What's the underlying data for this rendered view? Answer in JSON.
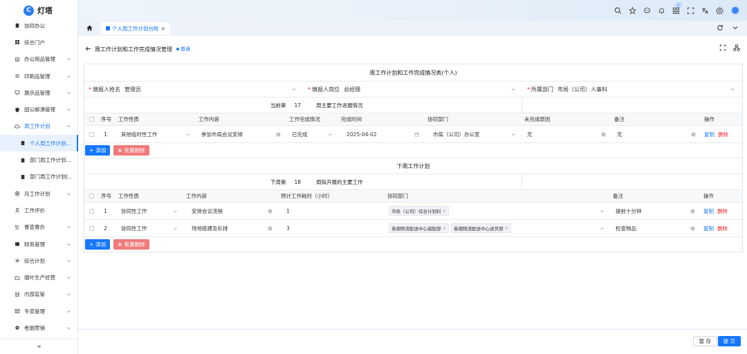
{
  "app": {
    "name": "灯塔",
    "logo_letter": "C"
  },
  "sidebar": {
    "items": [
      {
        "label": "协同办公",
        "icon": "doc-icon",
        "has_chevron": false
      },
      {
        "label": "综合门户",
        "icon": "grid-icon",
        "has_chevron": false
      },
      {
        "label": "办公用品管理",
        "icon": "box-icon",
        "has_chevron": true
      },
      {
        "label": "印刷品管理",
        "icon": "list-icon",
        "has_chevron": true
      },
      {
        "label": "展示品管理",
        "icon": "display-icon",
        "has_chevron": true
      },
      {
        "label": "固公邮湧管理",
        "icon": "shield-icon",
        "has_chevron": true
      },
      {
        "label": "周工作计划",
        "icon": "cloud-icon",
        "has_chevron": true,
        "open": true
      },
      {
        "label": "个人周工作计划...",
        "icon": "file-icon",
        "sub": true,
        "active": true
      },
      {
        "label": "部门周工作计划...",
        "icon": "file-icon",
        "sub": true
      },
      {
        "label": "部门周工作计划(...",
        "icon": "file-icon",
        "sub": true
      },
      {
        "label": "月工作计划",
        "icon": "target-icon",
        "has_chevron": true
      },
      {
        "label": "工作评价",
        "icon": "user-icon",
        "has_chevron": false
      },
      {
        "label": "督查督办",
        "icon": "flow-icon",
        "has_chevron": true
      },
      {
        "label": "财务管理",
        "icon": "finance-icon",
        "has_chevron": true
      },
      {
        "label": "综合计划",
        "icon": "sun-icon",
        "has_chevron": true
      },
      {
        "label": "烟叶生产经营",
        "icon": "folder-icon",
        "has_chevron": true
      },
      {
        "label": "内部监管",
        "icon": "monitor-icon",
        "has_chevron": true
      },
      {
        "label": "专卖管理",
        "icon": "table-icon",
        "has_chevron": true
      },
      {
        "label": "卷烟营销",
        "icon": "gear-icon",
        "has_chevron": true
      }
    ],
    "collapse_label": "«"
  },
  "topbar": {
    "badge": "新"
  },
  "tabs": {
    "active_label": "个人周工作计划台账",
    "close": "×"
  },
  "page": {
    "title": "周工作计划和工作完成情况管理",
    "status": "普通"
  },
  "form": {
    "title": "周工作计划和工作完成情况表(个人)",
    "fields": [
      {
        "label": "填报人姓名",
        "value": "管理员"
      },
      {
        "label": "填报人岗位",
        "value": "总经理"
      },
      {
        "label": "所属部门",
        "value": "市局（公司）人事科"
      }
    ],
    "current_week": {
      "label": "当前第",
      "value": "17",
      "desc": "周主要工作进展情况"
    },
    "current_table": {
      "headers": [
        "序号",
        "工作性质",
        "工作内容",
        "工作完成情况",
        "完成时间",
        "协同部门",
        "未完成原因",
        "备注",
        "操作"
      ],
      "rows": [
        {
          "no": "1",
          "nature": "其他临时性工作",
          "content": "参加市局会议安排",
          "status": "已完成",
          "date": "2025-04-02",
          "dept": "市局（公司）办公室",
          "reason": "无",
          "remark": "无"
        }
      ]
    },
    "add_label": "添加",
    "batch_delete_label": "批量删除",
    "next_title": "下周工作计划",
    "next_week": {
      "label": "下周第",
      "value": "18",
      "desc": "周拟开展的主要工作"
    },
    "next_table": {
      "headers": [
        "序号",
        "工作性质",
        "工作内容",
        "预计工作耗时（小时）",
        "协同部门",
        "备注",
        "操作"
      ],
      "rows": [
        {
          "no": "1",
          "nature": "协同性工作",
          "content": "安排会议流程",
          "hours": "1",
          "depts": [
            "市局（公司）综合计划科"
          ],
          "remark": "提前十分钟"
        },
        {
          "no": "2",
          "nature": "协同性工作",
          "content": "场地搭建及彩排",
          "hours": "3",
          "depts": [
            "卷烟物流配送中心储配部",
            "卷烟物流配送中心送货部"
          ],
          "remark": "检查物品"
        }
      ]
    },
    "edit_label": "复制",
    "delete_label": "删除"
  },
  "footer": {
    "save_label": "暂 存",
    "submit_label": "提 交"
  }
}
